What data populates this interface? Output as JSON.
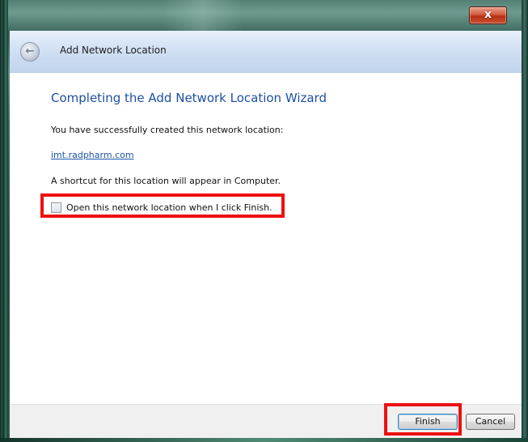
{
  "window": {
    "title": "Add Network Location",
    "close_glyph": "x",
    "back_glyph": "←"
  },
  "wizard": {
    "heading": "Completing the Add Network Location Wizard",
    "success_text": "You have successfully created this network location:",
    "location_link": "imt.radpharm.com",
    "shortcut_text": "A shortcut for this location will appear in Computer.",
    "checkbox_label": "Open this network location when I click Finish.",
    "checkbox_checked": false
  },
  "footer": {
    "finish_label": "Finish",
    "cancel_label": "Cancel"
  },
  "colors": {
    "heading": "#1e4fa3",
    "highlight": "#ee1010",
    "close_button": "#cc4125"
  },
  "icons": [
    "back-arrow-icon",
    "close-icon"
  ]
}
